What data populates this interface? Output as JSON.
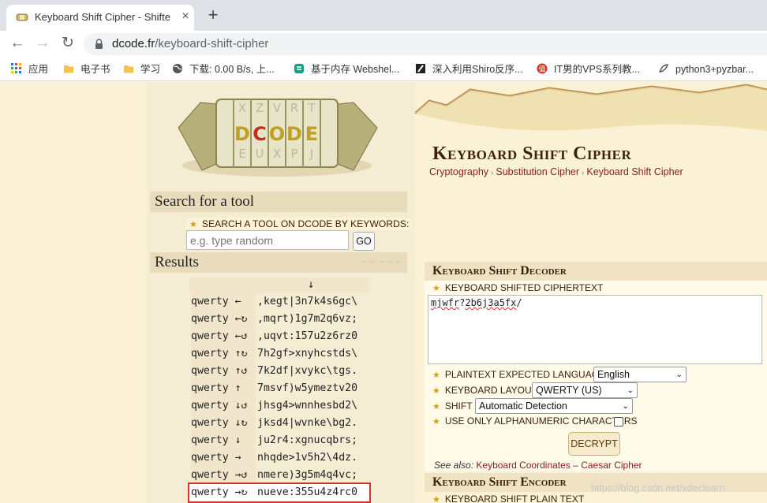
{
  "browser": {
    "tab_title": "Keyboard Shift Cipher - Shifte",
    "tab_close": "×",
    "new_tab": "+",
    "url_host": "dcode.fr",
    "url_path": "/keyboard-shift-cipher",
    "bookmarks": [
      {
        "label": "应用",
        "icon": "apps-grid-icon"
      },
      {
        "label": "电子书",
        "icon": "folder-icon"
      },
      {
        "label": "学习",
        "icon": "folder-icon"
      },
      {
        "label": "下载: 0.00 B/s, 上...",
        "icon": "globe-icon"
      },
      {
        "label": "基于内存 Webshel...",
        "icon": "teal-app-icon"
      },
      {
        "label": "深入利用Shiro反序...",
        "icon": "slash-logo-icon"
      },
      {
        "label": "IT男的VPS系列教...",
        "icon": "red-circle-icon"
      },
      {
        "label": "python3+pyzbar...",
        "icon": "feather-icon"
      }
    ]
  },
  "logo": {
    "text": "DCODE"
  },
  "search": {
    "heading": "Search for a tool",
    "label": "SEARCH A TOOL ON DCODE BY KEYWORDS:",
    "placeholder": "e.g. type random",
    "go_label": "GO"
  },
  "results": {
    "heading": "Results",
    "dashes": "– – – – –",
    "header_arrow": "↓",
    "rows": [
      {
        "method": "qwerty ←",
        "text": ",kegt|3n7k4s6gc\\"
      },
      {
        "method": "qwerty ←↻",
        "text": ",mqrt)1g7m2q6vz;"
      },
      {
        "method": "qwerty ←↺",
        "text": ",uqvt:157u2z6rz0"
      },
      {
        "method": "qwerty ↑↻",
        "text": "7h2gf>xnyhcstds\\"
      },
      {
        "method": "qwerty ↑↺",
        "text": "7k2df|xvykc\\tgs."
      },
      {
        "method": "qwerty ↑",
        "text": "7msvf)w5ymeztv20"
      },
      {
        "method": "qwerty ↓↺",
        "text": "jhsg4>wnnhesbd2\\"
      },
      {
        "method": "qwerty ↓↻",
        "text": "jksd4|wvnke\\bg2."
      },
      {
        "method": "qwerty ↓",
        "text": "ju2r4:xgnucqbrs;"
      },
      {
        "method": "qwerty →",
        "text": "nhqde>1v5h2\\4dz."
      },
      {
        "method": "qwerty →↺",
        "text": "nmere)3g5m4q4vc;"
      },
      {
        "method": "qwerty →↻",
        "text": "nueve:355u4z4rc0"
      }
    ]
  },
  "main": {
    "title": "Keyboard Shift Cipher",
    "breadcrumbs": [
      "Cryptography",
      "Substitution Cipher",
      "Keyboard Shift Cipher"
    ],
    "breadcrumb_sep": "›"
  },
  "decoder": {
    "heading": "Keyboard Shift Decoder",
    "ciphertext_label": "KEYBOARD SHIFTED CIPHERTEXT",
    "ciphertext_part1": "mjwfr",
    "ciphertext_part2": "?",
    "ciphertext_part3": "2b6j3a5fx",
    "ciphertext_part4": "/",
    "language_label": "PLAINTEXT EXPECTED LANGUAGE",
    "language_value": "English",
    "layout_label": "KEYBOARD LAYOUT",
    "layout_value": "QWERTY (US)",
    "shift_label": "SHIFT",
    "shift_value": "Automatic Detection",
    "alnum_label": "USE ONLY ALPHANUMERIC CHARACTERS",
    "decrypt_label": "DECRYPT",
    "see_also_label": "See also:",
    "see_also_links": [
      "Keyboard Coordinates",
      "Caesar Cipher"
    ],
    "see_also_sep": "–"
  },
  "encoder": {
    "heading": "Keyboard Shift Encoder",
    "plaintext_label": "KEYBOARD SHIFT PLAIN TEXT"
  },
  "watermark": "https://blog.csdn.net/xdeclearn",
  "colors": {
    "accent_red": "#8b1a1a",
    "highlight_red": "#d0342c",
    "parchment": "#fbf2d6",
    "heading_brown": "#3d2208"
  }
}
